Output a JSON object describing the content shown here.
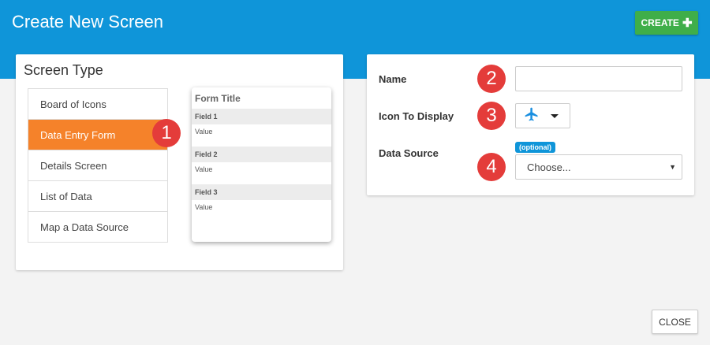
{
  "header": {
    "title": "Create New Screen",
    "create_label": "CREATE"
  },
  "screen_type": {
    "title": "Screen Type",
    "items": [
      {
        "label": "Board of Icons"
      },
      {
        "label": "Data Entry Form"
      },
      {
        "label": "Details Screen"
      },
      {
        "label": "List of Data"
      },
      {
        "label": "Map a Data Source"
      }
    ],
    "selected": "Data Entry Form"
  },
  "preview": {
    "title": "Form Title",
    "fields": [
      {
        "label": "Field 1",
        "value": "Value"
      },
      {
        "label": "Field 2",
        "value": "Value"
      },
      {
        "label": "Field 3",
        "value": "Value"
      }
    ]
  },
  "form": {
    "name_label": "Name",
    "name_value": "",
    "icon_label": "Icon To Display",
    "icon_selected": "airplane-icon",
    "data_source_label": "Data Source",
    "optional_tag": "(optional)",
    "data_source_value": "Choose..."
  },
  "badges": [
    "1",
    "2",
    "3",
    "4"
  ],
  "close_label": "CLOSE",
  "colors": {
    "header": "#0f95d9",
    "create": "#3fae49",
    "selected": "#f5822a",
    "badge": "#e43c3a",
    "icon": "#1a8fe0"
  }
}
